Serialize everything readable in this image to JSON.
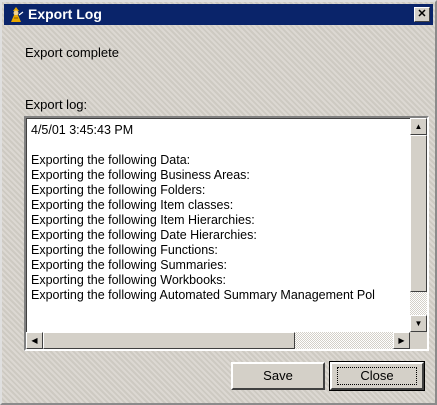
{
  "window": {
    "title": "Export Log",
    "title_icon": "wizard-icon",
    "close_glyph": "✕"
  },
  "status_text": "Export complete",
  "log_label": "Export log:",
  "log_lines": [
    "4/5/01 3:45:43 PM",
    "",
    "Exporting the following Data:",
    "Exporting the following Business Areas:",
    "Exporting the following Folders:",
    "Exporting the following Item classes:",
    "Exporting the following Item Hierarchies:",
    "Exporting the following Date Hierarchies:",
    "Exporting the following Functions:",
    "Exporting the following Summaries:",
    "Exporting the following Workbooks:",
    "Exporting the following Automated Summary Management Pol"
  ],
  "scroll_glyphs": {
    "up": "▲",
    "down": "▼",
    "left": "◀",
    "right": "▶"
  },
  "buttons": {
    "save_label": "Save",
    "close_label": "Close"
  },
  "colors": {
    "titlebar": "#0a246a",
    "face": "#d4d0c8"
  }
}
